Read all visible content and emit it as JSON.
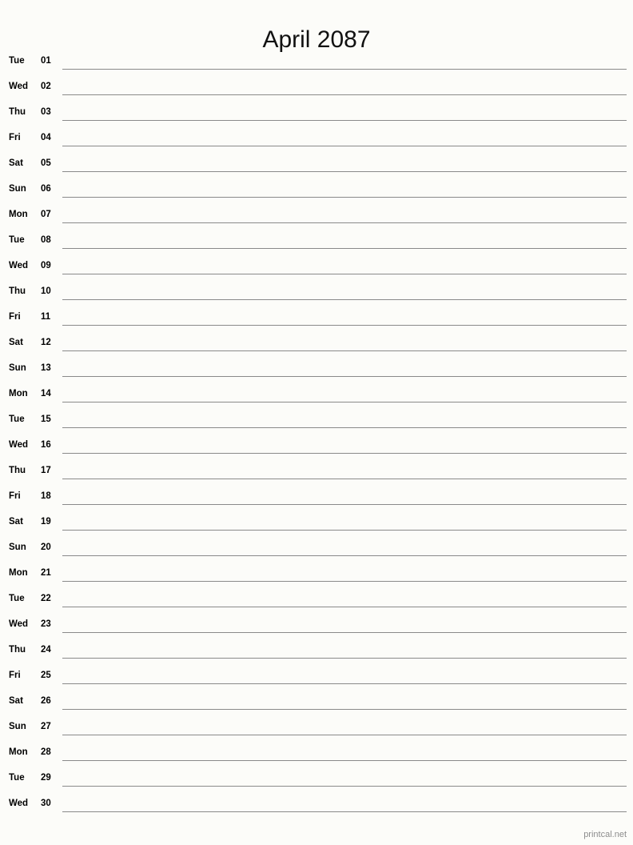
{
  "page": {
    "title": "April 2087",
    "month_name": "April",
    "year": "2087",
    "background_color": "#fcfcf9",
    "line_color": "#8a8a8a",
    "text_color": "#000000"
  },
  "footer": {
    "credit": "printcal.net",
    "color": "#8d8d8d"
  },
  "days": [
    {
      "weekday": "Tue",
      "date": "01"
    },
    {
      "weekday": "Wed",
      "date": "02"
    },
    {
      "weekday": "Thu",
      "date": "03"
    },
    {
      "weekday": "Fri",
      "date": "04"
    },
    {
      "weekday": "Sat",
      "date": "05"
    },
    {
      "weekday": "Sun",
      "date": "06"
    },
    {
      "weekday": "Mon",
      "date": "07"
    },
    {
      "weekday": "Tue",
      "date": "08"
    },
    {
      "weekday": "Wed",
      "date": "09"
    },
    {
      "weekday": "Thu",
      "date": "10"
    },
    {
      "weekday": "Fri",
      "date": "11"
    },
    {
      "weekday": "Sat",
      "date": "12"
    },
    {
      "weekday": "Sun",
      "date": "13"
    },
    {
      "weekday": "Mon",
      "date": "14"
    },
    {
      "weekday": "Tue",
      "date": "15"
    },
    {
      "weekday": "Wed",
      "date": "16"
    },
    {
      "weekday": "Thu",
      "date": "17"
    },
    {
      "weekday": "Fri",
      "date": "18"
    },
    {
      "weekday": "Sat",
      "date": "19"
    },
    {
      "weekday": "Sun",
      "date": "20"
    },
    {
      "weekday": "Mon",
      "date": "21"
    },
    {
      "weekday": "Tue",
      "date": "22"
    },
    {
      "weekday": "Wed",
      "date": "23"
    },
    {
      "weekday": "Thu",
      "date": "24"
    },
    {
      "weekday": "Fri",
      "date": "25"
    },
    {
      "weekday": "Sat",
      "date": "26"
    },
    {
      "weekday": "Sun",
      "date": "27"
    },
    {
      "weekday": "Mon",
      "date": "28"
    },
    {
      "weekday": "Tue",
      "date": "29"
    },
    {
      "weekday": "Wed",
      "date": "30"
    }
  ]
}
